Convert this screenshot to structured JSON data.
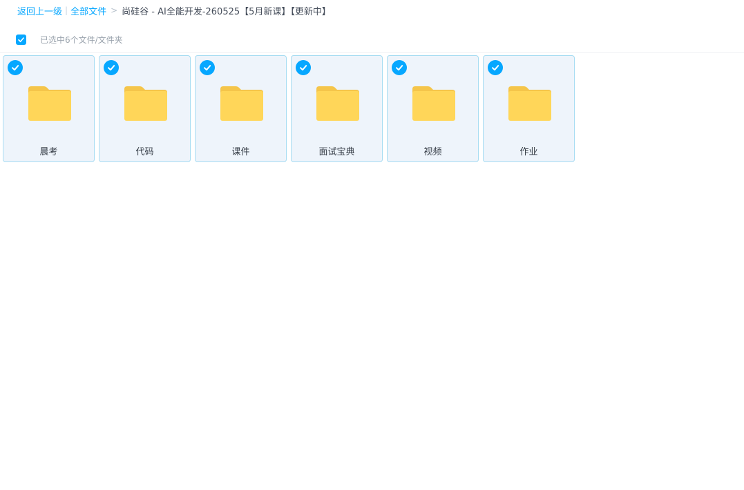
{
  "breadcrumb": {
    "back_label": "返回上一级",
    "separator": "|",
    "all_files_label": "全部文件",
    "arrow": ">",
    "current_folder": "尚硅谷 - AI全能开发-260525【5月新课】【更新中】"
  },
  "selection": {
    "checked": true,
    "count_text": "已选中6个文件/文件夹"
  },
  "folders": [
    {
      "name": "晨考",
      "icon": "folder-icon",
      "selected": true
    },
    {
      "name": "代码",
      "icon": "folder-icon",
      "selected": true
    },
    {
      "name": "课件",
      "icon": "folder-icon",
      "selected": true
    },
    {
      "name": "面试宝典",
      "icon": "folder-icon",
      "selected": true
    },
    {
      "name": "视频",
      "icon": "folder-icon",
      "selected": true
    },
    {
      "name": "作业",
      "icon": "folder-icon",
      "selected": true
    }
  ],
  "colors": {
    "accent": "#06a7ff",
    "folder_body": "#ffd659",
    "folder_tab": "#f5c54a",
    "card_bg": "#eef4fb",
    "card_border": "#a6dcf2"
  }
}
